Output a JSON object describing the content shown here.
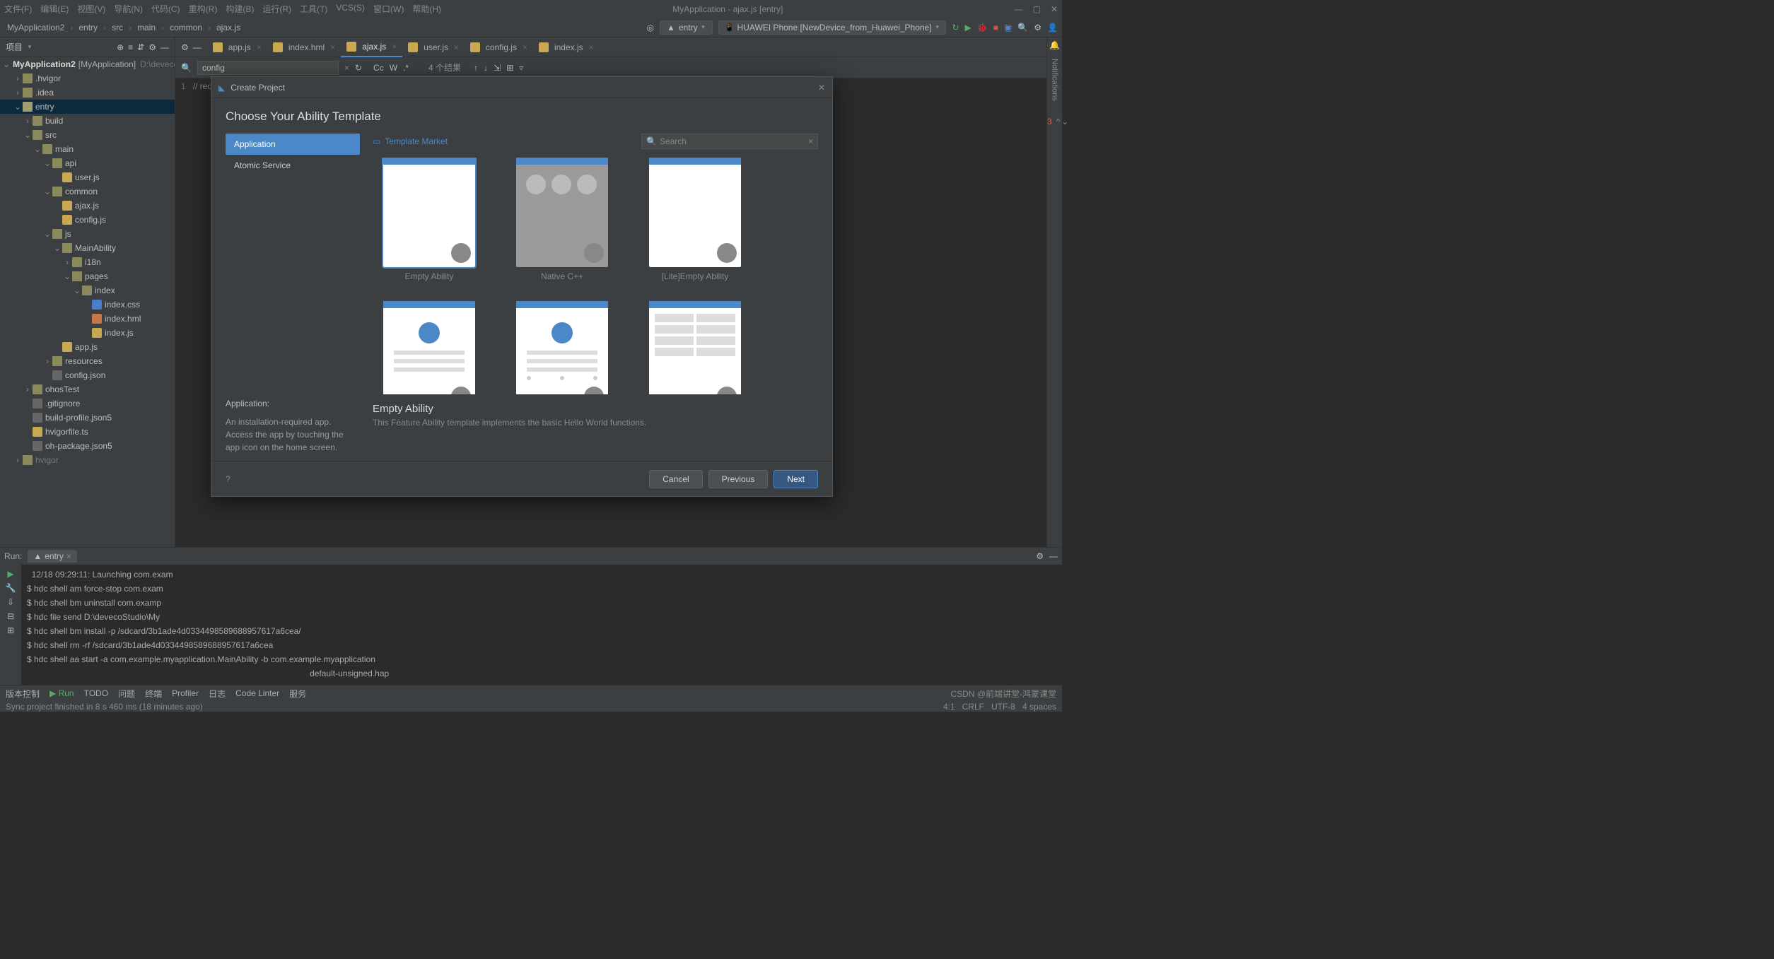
{
  "menus": [
    "文件(F)",
    "编辑(E)",
    "视图(V)",
    "导航(N)",
    "代码(C)",
    "重构(R)",
    "构建(B)",
    "运行(R)",
    "工具(T)",
    "VCS(S)",
    "窗口(W)",
    "帮助(H)"
  ],
  "window_title": "MyApplication - ajax.js [entry]",
  "breadcrumbs": [
    "MyApplication2",
    "entry",
    "src",
    "main",
    "common",
    "ajax.js"
  ],
  "run_config": "entry",
  "device": "HUAWEI Phone [NewDevice_from_Huawei_Phone]",
  "project_panel": {
    "title": "项目"
  },
  "project_root": {
    "name": "MyApplication2",
    "module": "[MyApplication]",
    "path": "D:\\devecoStudio\\MyApplication"
  },
  "tree": [
    {
      "d": 1,
      "a": "›",
      "i": "folder",
      "t": ".hvigor"
    },
    {
      "d": 1,
      "a": "›",
      "i": "folder",
      "t": ".idea"
    },
    {
      "d": 1,
      "a": "⌄",
      "i": "folder-o",
      "t": "entry",
      "sel": true
    },
    {
      "d": 2,
      "a": "›",
      "i": "folder",
      "t": "build"
    },
    {
      "d": 2,
      "a": "⌄",
      "i": "folder",
      "t": "src"
    },
    {
      "d": 3,
      "a": "⌄",
      "i": "folder",
      "t": "main"
    },
    {
      "d": 4,
      "a": "⌄",
      "i": "folder",
      "t": "api"
    },
    {
      "d": 5,
      "a": "",
      "i": "js",
      "t": "user.js"
    },
    {
      "d": 4,
      "a": "⌄",
      "i": "folder",
      "t": "common"
    },
    {
      "d": 5,
      "a": "",
      "i": "js",
      "t": "ajax.js"
    },
    {
      "d": 5,
      "a": "",
      "i": "js",
      "t": "config.js"
    },
    {
      "d": 4,
      "a": "⌄",
      "i": "folder",
      "t": "js"
    },
    {
      "d": 5,
      "a": "⌄",
      "i": "folder",
      "t": "MainAbility"
    },
    {
      "d": 6,
      "a": "›",
      "i": "folder",
      "t": "i18n"
    },
    {
      "d": 6,
      "a": "⌄",
      "i": "folder",
      "t": "pages"
    },
    {
      "d": 7,
      "a": "⌄",
      "i": "folder",
      "t": "index"
    },
    {
      "d": 8,
      "a": "",
      "i": "css",
      "t": "index.css"
    },
    {
      "d": 8,
      "a": "",
      "i": "hml",
      "t": "index.hml"
    },
    {
      "d": 8,
      "a": "",
      "i": "js",
      "t": "index.js"
    },
    {
      "d": 5,
      "a": "",
      "i": "js",
      "t": "app.js"
    },
    {
      "d": 4,
      "a": "›",
      "i": "folder",
      "t": "resources"
    },
    {
      "d": 4,
      "a": "",
      "i": "json",
      "t": "config.json"
    },
    {
      "d": 2,
      "a": "›",
      "i": "folder",
      "t": "ohosTest"
    },
    {
      "d": 2,
      "a": "",
      "i": "json",
      "t": ".gitignore"
    },
    {
      "d": 2,
      "a": "",
      "i": "json",
      "t": "build-profile.json5"
    },
    {
      "d": 2,
      "a": "",
      "i": "js",
      "t": "hvigorfile.ts"
    },
    {
      "d": 2,
      "a": "",
      "i": "json",
      "t": "oh-package.json5"
    },
    {
      "d": 1,
      "a": "›",
      "i": "folder",
      "t": "hvigor",
      "dim": true
    }
  ],
  "tabs": [
    {
      "name": "app.js",
      "active": false
    },
    {
      "name": "index.hml",
      "active": false
    },
    {
      "name": "ajax.js",
      "active": true
    },
    {
      "name": "user.js",
      "active": false
    },
    {
      "name": "config.js",
      "active": false
    },
    {
      "name": "index.js",
      "active": false
    }
  ],
  "find": {
    "value": "config",
    "results": "4 个结果"
  },
  "editor_line": "// request.js",
  "errors_count": "3",
  "run": {
    "label": "Run:",
    "tab": "entry",
    "lines": [
      "  12/18 09:29:11: Launching com.exam",
      "$ hdc shell am force-stop com.exam",
      "$ hdc shell bm uninstall com.examp",
      "$ hdc file send D:\\devecoStudio\\My",
      "$ hdc shell bm install -p /sdcard/3b1ade4d0334498589688957617a6cea/",
      "$ hdc shell rm -rf /sdcard/3b1ade4d0334498589688957617a6cea",
      "$ hdc shell aa start -a com.example.myapplication.MainAbility -b com.example.myapplication"
    ],
    "extra_line": "default-unsigned.hap"
  },
  "bottom_items": [
    "版本控制",
    "Run",
    "TODO",
    "问题",
    "终端",
    "Profiler",
    "日志",
    "Code Linter",
    "服务"
  ],
  "bottom_run_label": "▶ Run",
  "status_left": "Sync project finished in 8 s 460 ms (18 minutes ago)",
  "status_right": [
    "4:1",
    "CRLF",
    "UTF-8",
    "4 spaces"
  ],
  "watermark": "CSDN @前端讲堂-鸿蒙课堂",
  "modal": {
    "title": "Create Project",
    "heading": "Choose Your Ability Template",
    "cats": [
      "Application",
      "Atomic Service"
    ],
    "desc_title": "Application:",
    "desc_body": "An installation-required app. Access the app by touching the app icon on the home screen.",
    "market": "Template Market",
    "search_placeholder": "Search",
    "templates": [
      {
        "name": "Empty Ability",
        "variant": "empty",
        "selected": true
      },
      {
        "name": "Native C++",
        "variant": "native"
      },
      {
        "name": "[Lite]Empty Ability",
        "variant": "empty"
      },
      {
        "name": "",
        "variant": "about"
      },
      {
        "name": "",
        "variant": "list"
      },
      {
        "name": "",
        "variant": "category"
      }
    ],
    "selected_name": "Empty Ability",
    "selected_desc": "This Feature Ability template implements the basic Hello World functions.",
    "buttons": {
      "cancel": "Cancel",
      "prev": "Previous",
      "next": "Next"
    }
  }
}
